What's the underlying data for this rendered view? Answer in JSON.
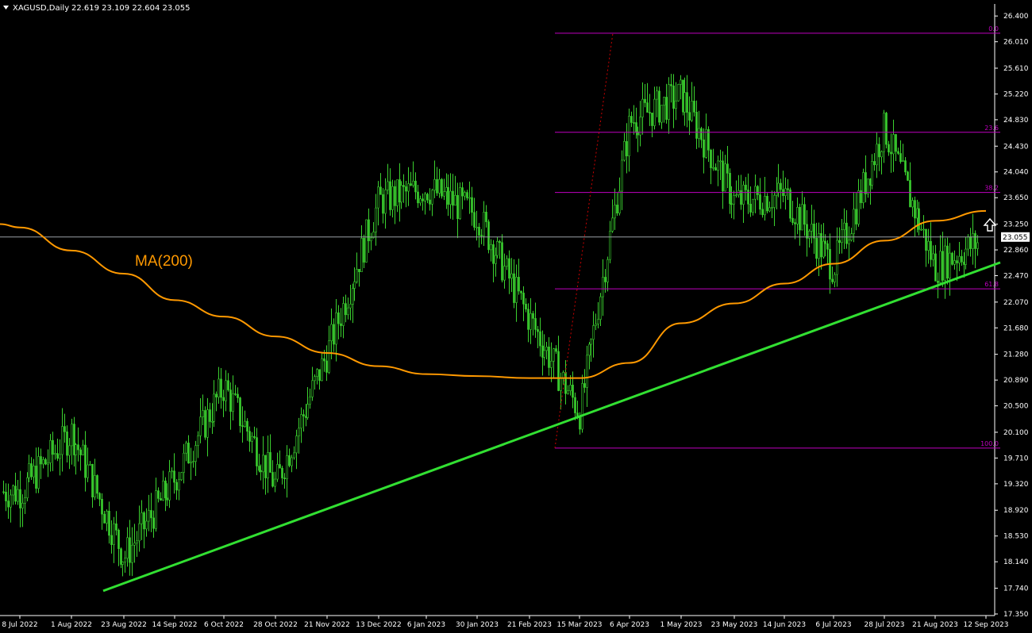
{
  "header": {
    "symbol": "XAGUSD,Daily",
    "ohlc": "22.619 23.109 22.604 23.055",
    "menu_icon": "triangle-down-icon"
  },
  "colors": {
    "background": "#000000",
    "candle": "#3bd12f",
    "grid_axis": "#ffffff",
    "fib": "#c000c0",
    "ma": "#ff9900",
    "trendline": "#32e032",
    "price_line": "#9aa0a6",
    "fib_zigzag": "#cc0000"
  },
  "chart_data": {
    "type": "candlestick",
    "instrument": "XAGUSD",
    "timeframe": "Daily",
    "last_price": "23.055",
    "ylim": [
      17.35,
      26.45
    ],
    "y_ticks": [
      "26.400",
      "26.010",
      "25.610",
      "25.220",
      "24.830",
      "24.430",
      "24.040",
      "23.650",
      "23.250",
      "22.860",
      "22.470",
      "22.070",
      "21.680",
      "21.280",
      "20.890",
      "20.500",
      "20.100",
      "19.710",
      "19.320",
      "18.920",
      "18.530",
      "18.140",
      "17.740",
      "17.350"
    ],
    "x_ticks": [
      "8 Jul 2022",
      "1 Aug 2022",
      "23 Aug 2022",
      "14 Sep 2022",
      "6 Oct 2022",
      "28 Oct 2022",
      "21 Nov 2022",
      "13 Dec 2022",
      "6 Jan 2023",
      "30 Jan 2023",
      "21 Feb 2023",
      "15 Mar 2023",
      "6 Apr 2023",
      "1 May 2023",
      "23 May 2023",
      "14 Jun 2023",
      "6 Jul 2023",
      "28 Jul 2023",
      "21 Aug 2023",
      "12 Sep 2023"
    ],
    "close_path": [
      [
        "8 Jul 2022",
        19.2
      ],
      [
        "1 Aug 2022",
        20.1
      ],
      [
        "23 Aug 2022",
        18.2
      ],
      [
        "14 Sep 2022",
        19.4
      ],
      [
        "6 Oct 2022",
        20.8
      ],
      [
        "28 Oct 2022",
        19.3
      ],
      [
        "21 Nov 2022",
        21.3
      ],
      [
        "13 Dec 2022",
        23.6
      ],
      [
        "6 Jan 2023",
        23.8
      ],
      [
        "30 Jan 2023",
        23.4
      ],
      [
        "21 Feb 2023",
        21.8
      ],
      [
        "15 Mar 2023",
        20.4
      ],
      [
        "6 Apr 2023",
        24.8
      ],
      [
        "1 May 2023",
        25.2
      ],
      [
        "23 May 2023",
        23.6
      ],
      [
        "14 Jun 2023",
        23.7
      ],
      [
        "6 Jul 2023",
        22.6
      ],
      [
        "28 Jul 2023",
        24.7
      ],
      [
        "21 Aug 2023",
        22.6
      ],
      [
        "12 Sep 2023",
        23.05
      ]
    ],
    "moving_average": {
      "label": "MA(200)",
      "points": [
        [
          "8 Jul 2022",
          23.2
        ],
        [
          "1 Aug 2022",
          22.85
        ],
        [
          "23 Aug 2022",
          22.5
        ],
        [
          "14 Sep 2022",
          22.1
        ],
        [
          "6 Oct 2022",
          21.85
        ],
        [
          "28 Oct 2022",
          21.55
        ],
        [
          "21 Nov 2022",
          21.3
        ],
        [
          "13 Dec 2022",
          21.1
        ],
        [
          "6 Jan 2023",
          20.98
        ],
        [
          "30 Jan 2023",
          20.95
        ],
        [
          "21 Feb 2023",
          20.92
        ],
        [
          "15 Mar 2023",
          20.92
        ],
        [
          "6 Apr 2023",
          21.15
        ],
        [
          "1 May 2023",
          21.75
        ],
        [
          "23 May 2023",
          22.05
        ],
        [
          "14 Jun 2023",
          22.35
        ],
        [
          "6 Jul 2023",
          22.65
        ],
        [
          "28 Jul 2023",
          23.0
        ],
        [
          "21 Aug 2023",
          23.3
        ],
        [
          "12 Sep 2023",
          23.45
        ]
      ]
    },
    "trendline": {
      "from": [
        "23 Aug 2022",
        17.7
      ],
      "to": [
        "12 Sep 2023",
        22.67
      ]
    },
    "fibonacci": {
      "levels": [
        {
          "label": "0.0",
          "value": 26.14
        },
        {
          "label": "23.6",
          "value": 24.64
        },
        {
          "label": "38.2",
          "value": 23.73
        },
        {
          "label": "61.8",
          "value": 22.27
        },
        {
          "label": "100.0",
          "value": 19.86
        }
      ]
    }
  }
}
